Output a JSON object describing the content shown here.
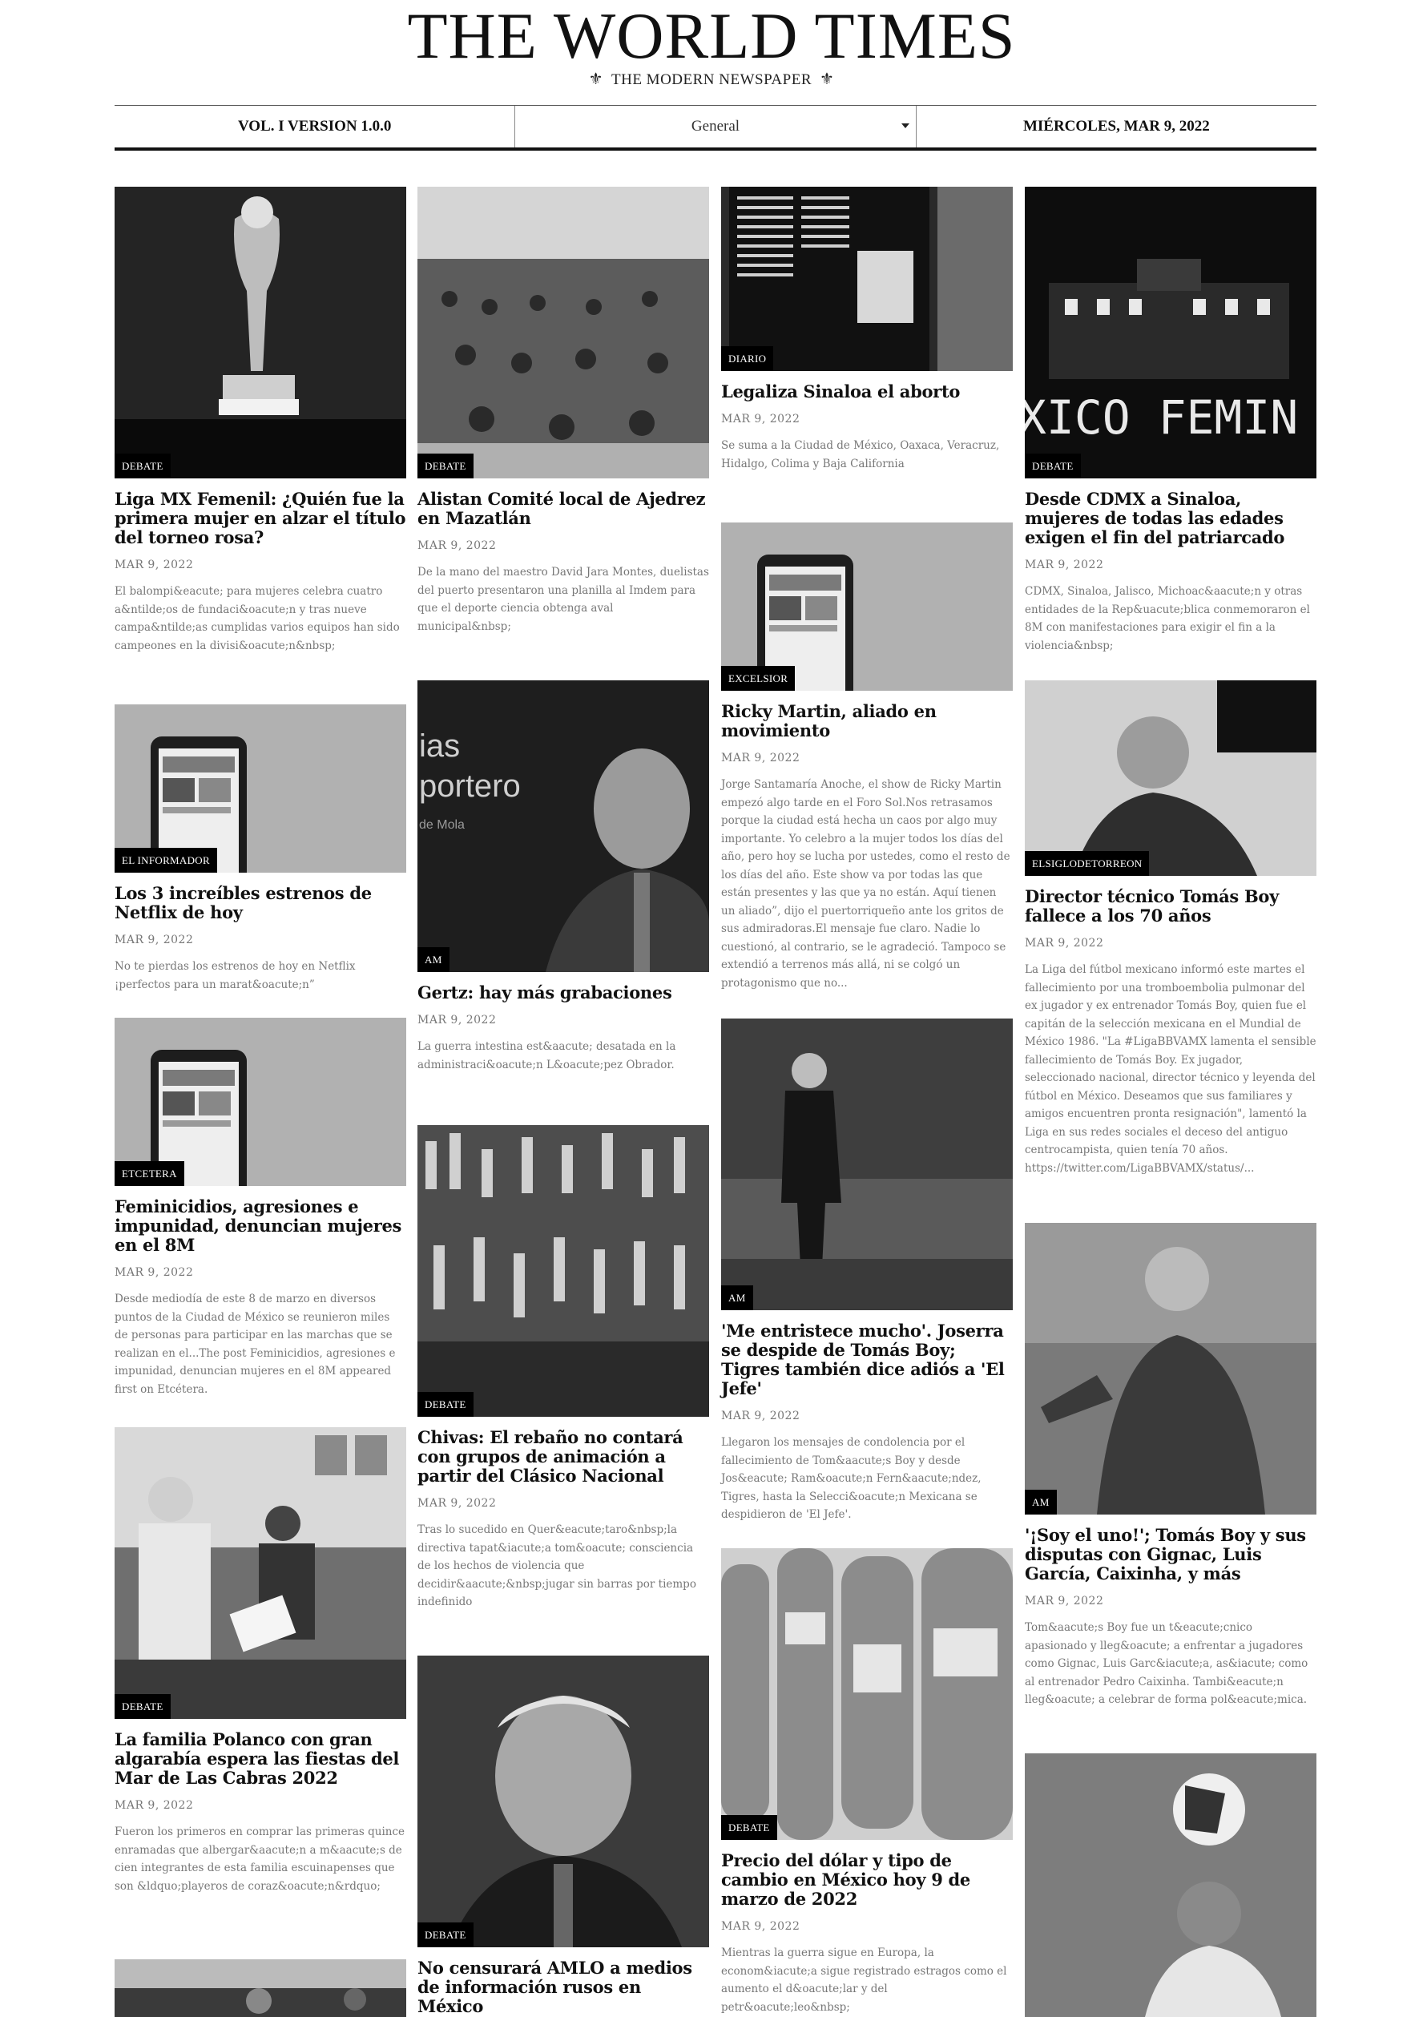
{
  "site": {
    "title": "THE WORLD TIMES",
    "tagline": "THE MODERN NEWSPAPER"
  },
  "infobar": {
    "version": "VOL. I VERSION 1.0.0",
    "category": "General",
    "date": "MIÉRCOLES, MAR 9, 2022"
  },
  "articles": [
    {
      "source": "DEBATE",
      "title": "Liga MX Femenil: ¿Quién fue la primera mujer en alzar el título del torneo rosa?",
      "date": "MAR 9, 2022",
      "excerpt": "El balompi&eacute; para mujeres celebra cuatro a&ntilde;os de fundaci&oacute;n y tras nueve campa&ntilde;as cumplidas varios equipos han sido campeones en la divisi&oacute;n&nbsp;"
    },
    {
      "source": "EL INFORMADOR",
      "title": "Los 3 increíbles estrenos de Netflix de hoy",
      "date": "MAR 9, 2022",
      "excerpt": "No te pierdas los estrenos de hoy en Netflix ¡perfectos para un marat&oacute;n”"
    },
    {
      "source": "ETCETERA",
      "title": "Feminicidios, agresiones e impunidad, denuncian mujeres en el 8M",
      "date": "MAR 9, 2022",
      "excerpt": "Desde mediodía de este 8 de marzo en diversos puntos de la Ciudad de México se reunieron miles de personas para participar en las marchas que se realizan en el...The post Feminicidios, agresiones e impunidad, denuncian mujeres en el 8M appeared first on Etcétera."
    },
    {
      "source": "DEBATE",
      "title": "La familia Polanco con gran algarabía espera las fiestas del Mar de Las Cabras 2022",
      "date": "MAR 9, 2022",
      "excerpt": "Fueron los primeros en comprar las primeras quince enramadas que albergar&aacute;n a m&aacute;s de cien integrantes de esta familia escuinapenses que son &ldquo;playeros de coraz&oacute;n&rdquo;"
    },
    {
      "source": "DEBATE",
      "title": "Alistan Comité local de Ajedrez en Mazatlán",
      "date": "MAR 9, 2022",
      "excerpt": "De la mano del maestro David Jara Montes, duelistas del puerto presentaron una planilla al Imdem para que el deporte ciencia obtenga aval municipal&nbsp;"
    },
    {
      "source": "AM",
      "title": "Gertz: hay más grabaciones",
      "date": "MAR 9, 2022",
      "excerpt": "La guerra intestina est&aacute; desatada en la administraci&oacute;n L&oacute;pez Obrador."
    },
    {
      "source": "DEBATE",
      "title": "Chivas: El rebaño no contará con grupos de animación a partir del Clásico Nacional",
      "date": "MAR 9, 2022",
      "excerpt": "Tras lo sucedido en Quer&eacute;taro&nbsp;la directiva tapat&iacute;a tom&oacute; consciencia de los hechos de violencia que decidir&aacute;&nbsp;jugar sin barras por tiempo indefinido"
    },
    {
      "source": "DEBATE",
      "title": "No censurará AMLO a medios de información rusos en México",
      "date": "",
      "excerpt": ""
    },
    {
      "source": "DIARIO",
      "title": "Legaliza Sinaloa el aborto",
      "date": "MAR 9, 2022",
      "excerpt": "Se suma a la Ciudad de México, Oaxaca, Veracruz, Hidalgo, Colima y Baja California"
    },
    {
      "source": "EXCELSIOR",
      "title": "Ricky Martin, aliado en movimiento",
      "date": "MAR 9, 2022",
      "excerpt": "Jorge Santamaría Anoche, el show de Ricky Martin empezó algo tarde en el Foro Sol.Nos retrasamos porque la ciudad está hecha un caos por algo muy importante. Yo celebro a la mujer todos los días del año, pero hoy se lucha por ustedes, como el resto de los días del año. Este show va por todas las que están presentes y las que ya no están. Aquí tienen un aliado”, dijo el puertorriqueño ante los gritos de sus admiradoras.El mensaje fue claro. Nadie lo cuestionó, al contrario, se le agradeció. Tampoco se extendió a terrenos más allá, ni se colgó un protagonismo que no..."
    },
    {
      "source": "AM",
      "title": "'Me entristece mucho'. Joserra se despide de Tomás Boy; Tigres también dice adiós a 'El Jefe'",
      "date": "MAR 9, 2022",
      "excerpt": "Llegaron los mensajes de condolencia por el fallecimiento de Tom&aacute;s Boy y desde Jos&eacute; Ram&oacute;n Fern&aacute;ndez, Tigres, hasta la Selecci&oacute;n Mexicana se despidieron de 'El Jefe'."
    },
    {
      "source": "DEBATE",
      "title": "Precio del dólar y tipo de cambio en México hoy 9 de marzo de 2022",
      "date": "MAR 9, 2022",
      "excerpt": "Mientras la guerra sigue en Europa, la econom&iacute;a sigue registrado estragos como el aumento el d&oacute;lar y del petr&oacute;leo&nbsp;"
    },
    {
      "source": "DEBATE",
      "title": "Desde CDMX a Sinaloa, mujeres de todas las edades exigen el fin del patriarcado",
      "date": "MAR 9, 2022",
      "excerpt": "CDMX, Sinaloa, Jalisco, Michoac&aacute;n y otras entidades de la Rep&uacute;blica conmemoraron el 8M con manifestaciones para exigir el fin a la violencia&nbsp;"
    },
    {
      "source": "ELSIGLODETORREON",
      "title": "Director técnico Tomás Boy fallece a los 70 años",
      "date": "MAR 9, 2022",
      "excerpt": "   La Liga del fútbol mexicano informó este martes el fallecimiento por una tromboembolia pulmonar del ex jugador y ex entrenador Tomás Boy, quien fue el capitán de la selección mexicana en el Mundial de México 1986. \"La #LigaBBVAMX lamenta el sensible fallecimiento de Tomás Boy. Ex jugador, seleccionado nacional, director técnico y leyenda del fútbol en México. Deseamos que sus familiares y amigos encuentren pronta resignación\", lamentó la Liga en sus redes sociales el deceso del antiguo centrocampista, quien tenía 70 años. https://twitter.com/LigaBBVAMX/status/..."
    },
    {
      "source": "AM",
      "title": "'¡Soy el uno!'; Tomás Boy y sus disputas con Gignac, Luis García, Caixinha, y más",
      "date": "MAR 9, 2022",
      "excerpt": "Tom&aacute;s Boy fue un t&eacute;cnico apasionado y lleg&oacute; a enfrentar a jugadores como Gignac, Luis Garc&iacute;a, as&iacute; como al entrenador Pedro Caixinha. Tambi&eacute;n lleg&oacute; a celebrar de forma pol&eacute;mica."
    },
    {
      "source": "",
      "title": "",
      "date": "",
      "excerpt": ""
    },
    {
      "source": "",
      "title": "",
      "date": "",
      "excerpt": ""
    }
  ]
}
